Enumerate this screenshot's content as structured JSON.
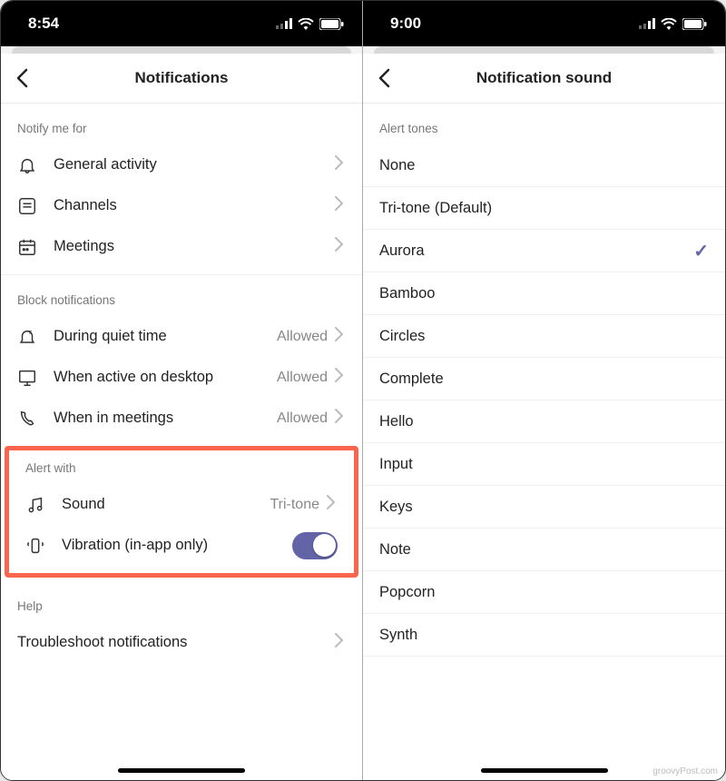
{
  "accent_color": "#6264a7",
  "highlight_color": "#fb654e",
  "watermark": "groovyPost.com",
  "left": {
    "status_time": "8:54",
    "title": "Notifications",
    "sections": {
      "notify_for": {
        "header": "Notify me for",
        "items": [
          {
            "icon": "bell-icon",
            "label": "General activity"
          },
          {
            "icon": "channel-icon",
            "label": "Channels"
          },
          {
            "icon": "calendar-icon",
            "label": "Meetings"
          }
        ]
      },
      "block": {
        "header": "Block notifications",
        "items": [
          {
            "icon": "quiet-icon",
            "label": "During quiet time",
            "value": "Allowed"
          },
          {
            "icon": "desktop-icon",
            "label": "When active on desktop",
            "value": "Allowed"
          },
          {
            "icon": "phone-call-icon",
            "label": "When in meetings",
            "value": "Allowed"
          }
        ]
      },
      "alert": {
        "header": "Alert with",
        "sound": {
          "label": "Sound",
          "value": "Tri-tone"
        },
        "vibration": {
          "label": "Vibration (in-app only)",
          "on": true
        }
      },
      "help": {
        "header": "Help",
        "items": [
          {
            "label": "Troubleshoot notifications"
          }
        ]
      }
    }
  },
  "right": {
    "status_time": "9:00",
    "title": "Notification sound",
    "section_header": "Alert tones",
    "tones": [
      {
        "label": "None",
        "selected": false
      },
      {
        "label": "Tri-tone (Default)",
        "selected": false
      },
      {
        "label": "Aurora",
        "selected": true
      },
      {
        "label": "Bamboo",
        "selected": false
      },
      {
        "label": "Circles",
        "selected": false
      },
      {
        "label": "Complete",
        "selected": false
      },
      {
        "label": "Hello",
        "selected": false
      },
      {
        "label": "Input",
        "selected": false
      },
      {
        "label": "Keys",
        "selected": false
      },
      {
        "label": "Note",
        "selected": false
      },
      {
        "label": "Popcorn",
        "selected": false
      },
      {
        "label": "Synth",
        "selected": false
      }
    ]
  }
}
